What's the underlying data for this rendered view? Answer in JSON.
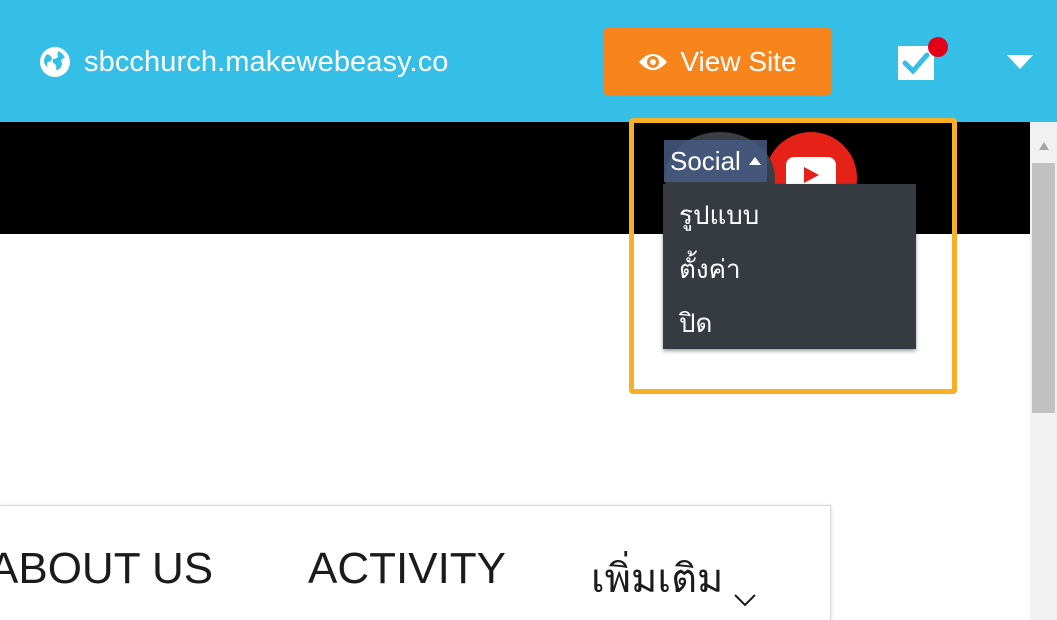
{
  "topbar": {
    "site_url": "sbcchurch.makewebeasy.co",
    "view_site_label": "View Site",
    "icons": [
      "globe-icon",
      "eye-icon",
      "tasks-check-icon",
      "notification-dot",
      "caret-down-icon"
    ]
  },
  "social_widget": {
    "label": "Social",
    "menu_items": [
      "รูปแบบ",
      "ตั้งค่า",
      "ปิด"
    ],
    "icons": [
      "caret-up-icon",
      "youtube-icon"
    ]
  },
  "nav": {
    "items": [
      "ABOUT US",
      "ACTIVITY"
    ],
    "more_label": "เพิ่มเติม",
    "more_icon": "chevron-down-icon"
  },
  "colors": {
    "topbar": "#35bfe6",
    "view_site": "#f7851c",
    "highlight": "#f6b026",
    "menu_bg": "#363b42",
    "youtube": "#e62117"
  }
}
